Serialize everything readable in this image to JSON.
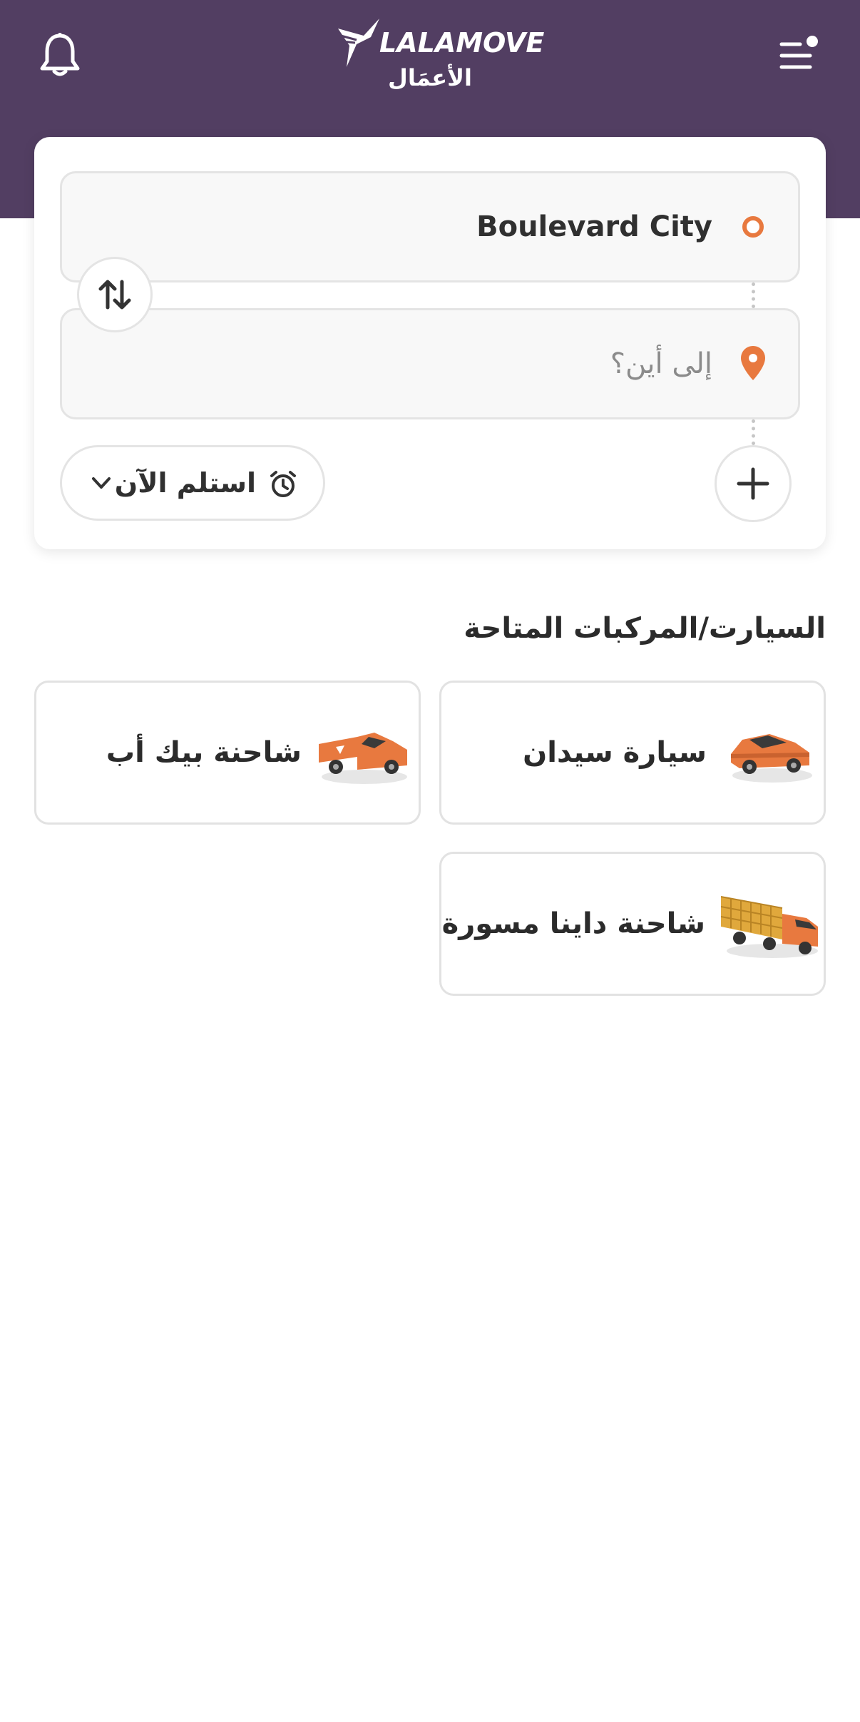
{
  "header": {
    "brand": "LALAMOVE",
    "subtitle": "الأعمَال"
  },
  "route": {
    "pickup_value": "Boulevard City",
    "dropoff_placeholder": "إلى أين؟",
    "pickup_time_label": "استلم الآن"
  },
  "vehicles": {
    "section_title": "السيارت/المركبات المتاحة",
    "items": [
      {
        "label": "سيارة سيدان",
        "icon": "sedan-car-icon"
      },
      {
        "label": "شاحنة بيك أب",
        "icon": "pickup-truck-icon"
      },
      {
        "label": "شاحنة داينا مسورة",
        "icon": "fenced-dyna-truck-icon"
      }
    ]
  },
  "colors": {
    "header_bg": "#523e62",
    "accent_orange": "#e8793f"
  }
}
